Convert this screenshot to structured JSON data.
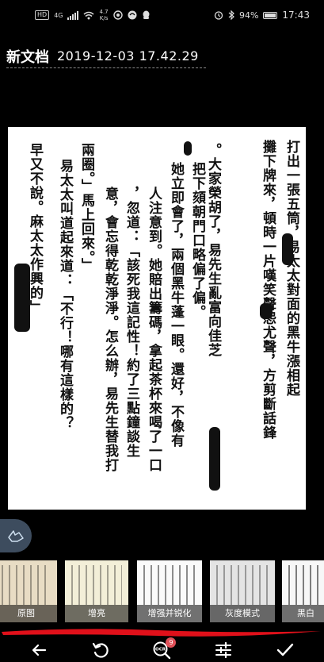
{
  "status_bar": {
    "network": "4G",
    "speed_value": "4.7",
    "speed_unit": "K/s",
    "battery": "94%",
    "time": "17:43"
  },
  "document": {
    "name": "新文档",
    "timestamp": "2019-12-03 17.42.29"
  },
  "page_text": {
    "columns": [
      "打出一張五筒，易太太對面的黑牛漲相起",
      "攤下牌來，頓時一片嘆笑聲怨尤聲，方剪斷話鋒",
      "。大家榮胡了，易先生亂富向佳芝",
      "把下頦朝門口略偏了偏。",
      "她立即會了，兩個黑牛蓬一眼。還好，不像有",
      "人注意到。她賠出籌碼，拿起茶杯來喝了一口",
      "，忽道：「該死我這記性！約了三點鐘談生",
      "意，會忘得乾乾淨淨。怎么辦，易先生替我打",
      "兩圈。」馬上回來。」",
      "易太太叫道起來道：「不行！哪有這樣的？",
      "早又不說。麻太太作興的」"
    ]
  },
  "filters": [
    {
      "label": "原图",
      "selected": false
    },
    {
      "label": "增亮",
      "selected": false
    },
    {
      "label": "增强并锐化",
      "selected": true
    },
    {
      "label": "灰度模式",
      "selected": false
    },
    {
      "label": "黑白",
      "selected": false
    }
  ],
  "toolbar": {
    "ocr_badge": "9"
  },
  "colors": {
    "accent": "#1fb6a6",
    "stroke_red": "#e0101a",
    "badge": "#e05058"
  }
}
